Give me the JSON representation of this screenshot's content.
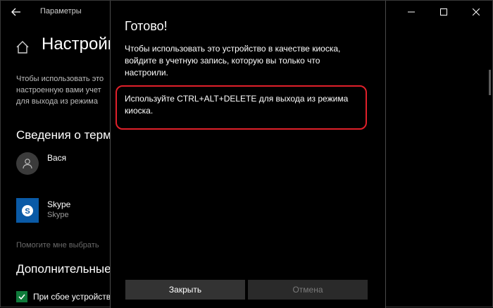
{
  "titlebar": {
    "app_title": "Параметры"
  },
  "page": {
    "heading": "Настройки",
    "description_lines": [
      "Чтобы использовать это",
      "настроенную вами учет",
      "для выхода из режима"
    ],
    "section_info": "Сведения о терм",
    "account_name": "Вася",
    "app": {
      "name": "Skype",
      "subtitle": "Skype"
    },
    "help_link": "Помогите мне выбрать",
    "section_advanced": "Дополнительные",
    "checkbox_label": "При сбое устройств"
  },
  "dialog": {
    "title": "Готово!",
    "body_lines": [
      "Чтобы использовать это устройство в качестве киоска,",
      "войдите в учетную запись, которую вы только что",
      "настроили."
    ],
    "note_lines": [
      "Используйте CTRL+ALT+DELETE для выхода из режима",
      "киоска."
    ],
    "close_label": "Закрыть",
    "cancel_label": "Отмена"
  },
  "colors": {
    "highlight": "#e0202a",
    "skype_blue": "#0a5aa6",
    "checkbox_green": "#0f7a3a"
  },
  "icons": [
    "back-arrow-icon",
    "minimize-icon",
    "maximize-icon",
    "close-icon",
    "home-icon",
    "person-icon",
    "skype-icon",
    "checkmark-icon"
  ]
}
